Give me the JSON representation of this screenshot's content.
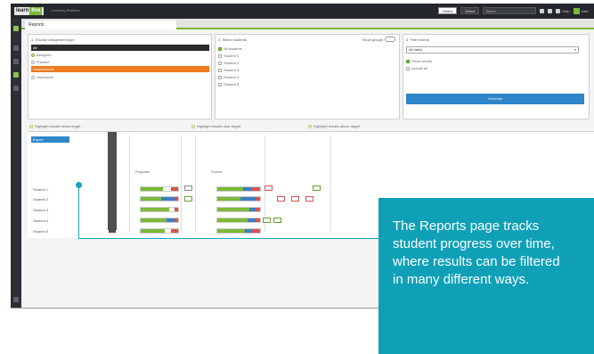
{
  "header": {
    "logo_text": "learn",
    "logo_badge": "live",
    "title": "Learning Platform",
    "buttons": [
      "Select",
      "Select"
    ],
    "selector": "Select",
    "help_label": "Help",
    "user_label": "User"
  },
  "tabs": [
    {
      "label": "Reports"
    }
  ],
  "panel_type": {
    "title": "1. Choose assignment type",
    "options": [
      {
        "label": "All",
        "state": "selected"
      },
      {
        "label": "Assigned",
        "state": "radio-on"
      },
      {
        "label": "Practice",
        "state": "radio"
      },
      {
        "label": "Assessments",
        "state": "highlighted"
      },
      {
        "label": "Homework",
        "state": "radio"
      }
    ]
  },
  "panel_students": {
    "title": "2. Select students",
    "toggle_label": "Show groups",
    "students": [
      {
        "label": "All students",
        "checked": true
      },
      {
        "label": "Student 1",
        "checked": false
      },
      {
        "label": "Student 2",
        "checked": false
      },
      {
        "label": "Student 3",
        "checked": false
      },
      {
        "label": "Student 4",
        "checked": false
      },
      {
        "label": "Student 5",
        "checked": false
      }
    ]
  },
  "panel_format": {
    "title": "3. Filter format",
    "dropdown_value": "All dates",
    "options": [
      {
        "label": "Show results",
        "checked": true
      },
      {
        "label": "Include all",
        "checked": false
      }
    ],
    "generate_label": "Generate"
  },
  "highlights": [
    "Highlight results below target",
    "Highlight results near target",
    "Highlight results above target"
  ],
  "results": {
    "export_label": "Export",
    "section_labels": [
      "Progress",
      "Scores"
    ],
    "students": [
      "Student 1",
      "Student 2",
      "Student 3",
      "Student 4",
      "Student 5"
    ],
    "rows": [
      {
        "percent": [
          60,
          20,
          20
        ]
      },
      {
        "percent": [
          55,
          35,
          10
        ]
      },
      {
        "percent": [
          75,
          15,
          10
        ]
      },
      {
        "percent": [
          70,
          20,
          10
        ]
      },
      {
        "percent": [
          65,
          15,
          20
        ]
      }
    ]
  },
  "callout": {
    "text": "The Reports page tracks student progress over time, where results can be filtered in many different ways."
  },
  "colors": {
    "accent_green": "#7cb83a",
    "accent_orange": "#ee7a1e",
    "accent_blue": "#2f86c8",
    "callout_teal": "#0fa0b8",
    "bar_red": "#d9534f",
    "bar_blue": "#3b7fc4"
  }
}
